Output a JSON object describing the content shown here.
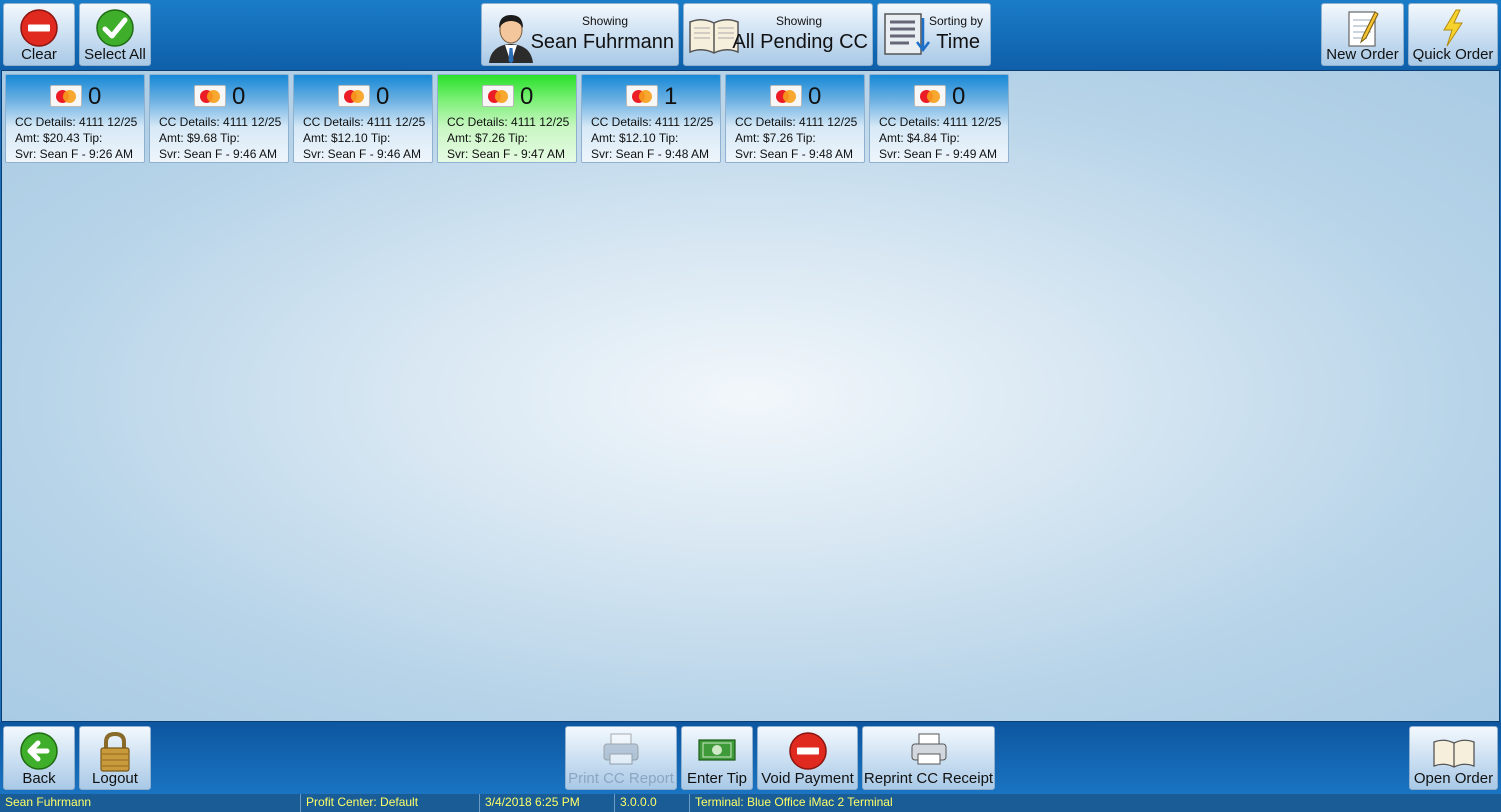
{
  "toolbar": {
    "clear_label": "Clear",
    "select_all_label": "Select All",
    "showing_server": {
      "small": "Showing",
      "big": "Sean Fuhrmann"
    },
    "showing_filter": {
      "small": "Showing",
      "big": "All Pending CC"
    },
    "sorting": {
      "small": "Sorting by",
      "big": "Time"
    },
    "new_order_label": "New Order",
    "quick_order_label": "Quick Order"
  },
  "cards": [
    {
      "count": "0",
      "details": "CC Details: 4111 12/25",
      "amount": "Amt: $20.43 Tip:",
      "server": "Svr: Sean F - 9:26 AM",
      "selected": false
    },
    {
      "count": "0",
      "details": "CC Details: 4111 12/25",
      "amount": "Amt: $9.68 Tip:",
      "server": "Svr: Sean F - 9:46 AM",
      "selected": false
    },
    {
      "count": "0",
      "details": "CC Details: 4111 12/25",
      "amount": "Amt: $12.10 Tip:",
      "server": "Svr: Sean F - 9:46 AM",
      "selected": false
    },
    {
      "count": "0",
      "details": "CC Details: 4111 12/25",
      "amount": "Amt: $7.26 Tip:",
      "server": "Svr: Sean F - 9:47 AM",
      "selected": true
    },
    {
      "count": "1",
      "details": "CC Details: 4111 12/25",
      "amount": "Amt: $12.10 Tip:",
      "server": "Svr: Sean F - 9:48 AM",
      "selected": false
    },
    {
      "count": "0",
      "details": "CC Details: 4111 12/25",
      "amount": "Amt: $7.26 Tip:",
      "server": "Svr: Sean F - 9:48 AM",
      "selected": false
    },
    {
      "count": "0",
      "details": "CC Details: 4111 12/25",
      "amount": "Amt: $4.84 Tip:",
      "server": "Svr: Sean F - 9:49 AM",
      "selected": false
    }
  ],
  "bottom": {
    "back_label": "Back",
    "logout_label": "Logout",
    "print_cc_report_label": "Print CC Report",
    "enter_tip_label": "Enter Tip",
    "void_payment_label": "Void Payment",
    "reprint_cc_receipt_label": "Reprint CC Receipt",
    "open_order_label": "Open Order"
  },
  "status": {
    "user": "Sean Fuhrmann",
    "profit_center": "Profit Center: Default",
    "datetime": "3/4/2018 6:25 PM",
    "version": "3.0.0.0",
    "terminal": "Terminal: Blue Office iMac 2 Terminal"
  },
  "colors": {
    "selected_card": "#29e02a",
    "status_text": "#ffff66",
    "bar_blue": "#1a74c2"
  },
  "icons": {
    "clear": "no-entry-icon",
    "select_all": "checkmark-icon",
    "server": "person-icon",
    "filter": "open-book-icon",
    "sort": "sort-list-icon",
    "new_order": "notepad-pencil-icon",
    "quick_order": "lightning-icon",
    "card": "mastercard-icon",
    "back": "back-arrow-icon",
    "logout": "padlock-icon",
    "print": "printer-icon",
    "tip": "money-icon",
    "void": "no-entry-icon",
    "reprint": "printer-icon",
    "open_order": "open-book-icon"
  }
}
